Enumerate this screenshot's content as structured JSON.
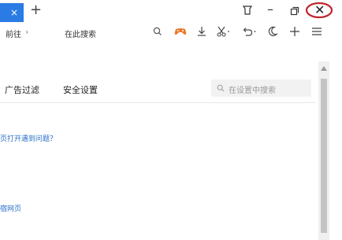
{
  "titlebar": {
    "tab_close_glyph": "×",
    "new_tab_glyph": "+",
    "minimize_glyph": "–",
    "close_glyph": "✕",
    "highlight_color": "#c0262d",
    "tab_color": "#2b7be4"
  },
  "toolbar": {
    "back_label": "前往",
    "crumb_separator": "›",
    "search_label": "在此搜索"
  },
  "settings": {
    "nav": {
      "ad_filter": "广告过滤",
      "security": "安全设置"
    },
    "search_placeholder": "在设置中搜索",
    "link_1": "页打开遇到问题？",
    "link_2": "宿网页"
  }
}
